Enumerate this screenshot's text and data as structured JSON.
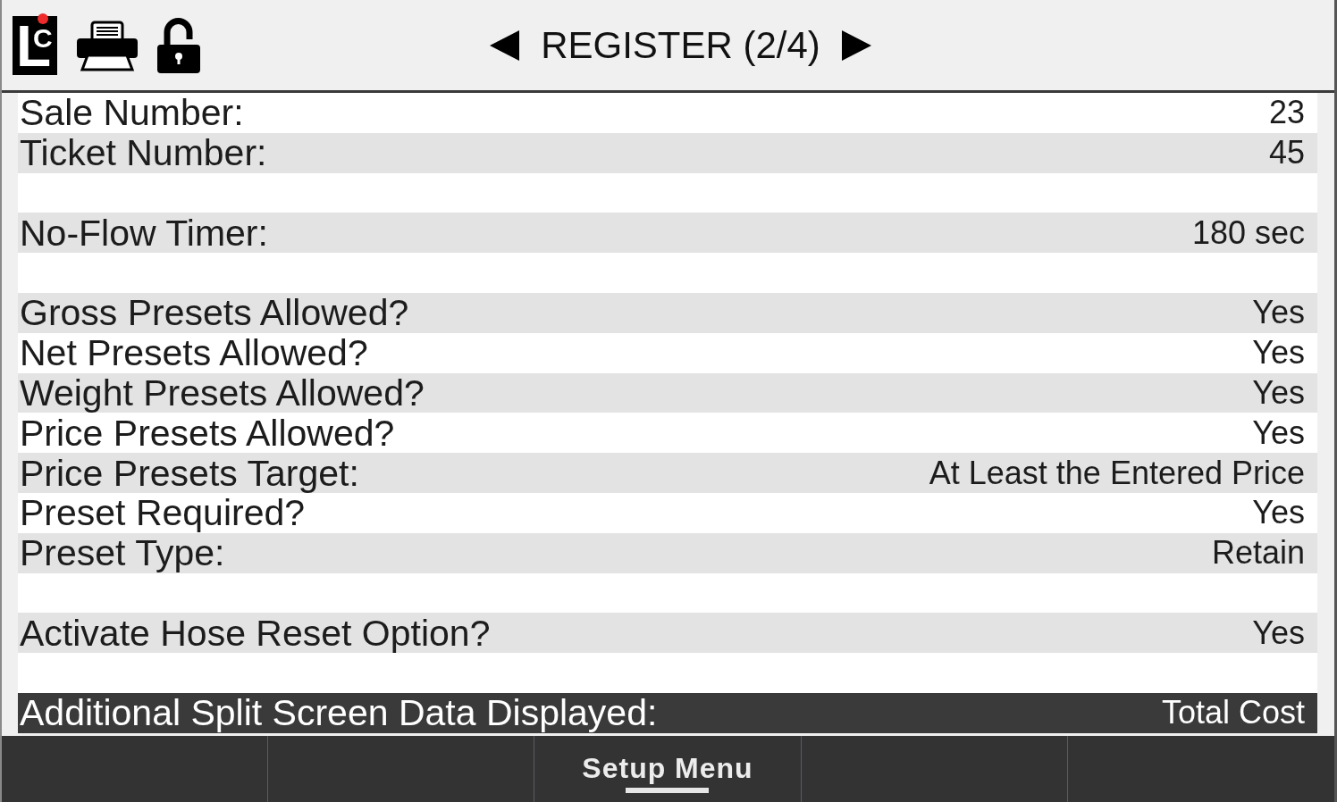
{
  "header": {
    "logo": {
      "letters": [
        "L",
        "C"
      ],
      "alert": true
    },
    "title": "REGISTER (2/4)"
  },
  "sections": [
    {
      "rows": [
        {
          "label": "Sale Number:",
          "value": "23",
          "selected": false
        },
        {
          "label": "Ticket Number:",
          "value": "45",
          "selected": false
        }
      ]
    },
    {
      "rows": [
        {
          "label": "No-Flow Timer:",
          "value": "180 sec",
          "selected": false
        }
      ]
    },
    {
      "rows": [
        {
          "label": "Gross Presets Allowed?",
          "value": "Yes",
          "selected": false
        },
        {
          "label": "Net Presets Allowed?",
          "value": "Yes",
          "selected": false
        },
        {
          "label": "Weight Presets Allowed?",
          "value": "Yes",
          "selected": false
        },
        {
          "label": "Price Presets Allowed?",
          "value": "Yes",
          "selected": false
        },
        {
          "label": "Price Presets Target:",
          "value": "At Least the Entered Price",
          "selected": false
        },
        {
          "label": "Preset Required?",
          "value": "Yes",
          "selected": false
        },
        {
          "label": "Preset Type:",
          "value": "Retain",
          "selected": false
        }
      ]
    },
    {
      "rows": [
        {
          "label": "Activate Hose Reset Option?",
          "value": "Yes",
          "selected": false
        }
      ]
    },
    {
      "rows": [
        {
          "label": "Additional Split Screen Data Displayed:",
          "value": "Total Cost",
          "selected": true
        }
      ]
    }
  ],
  "softkeys": [
    {
      "kind": "empty"
    },
    {
      "kind": "empty"
    },
    {
      "kind": "menu",
      "label": "Setup Menu"
    },
    {
      "kind": "empty"
    },
    {
      "kind": "empty"
    }
  ]
}
